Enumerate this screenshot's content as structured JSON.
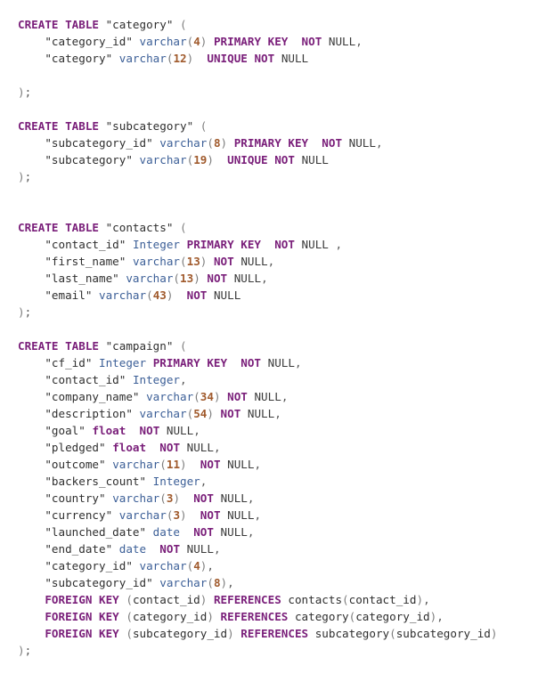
{
  "code_block": {
    "lines": [
      [
        [
          "kw",
          "CREATE TABLE"
        ],
        [
          "plain",
          " "
        ],
        [
          "str",
          "\"category\""
        ],
        [
          "plain",
          " "
        ],
        [
          "paren",
          "("
        ]
      ],
      [
        [
          "plain",
          "    "
        ],
        [
          "str",
          "\"category_id\""
        ],
        [
          "plain",
          " "
        ],
        [
          "type",
          "varchar"
        ],
        [
          "paren",
          "("
        ],
        [
          "num",
          "4"
        ],
        [
          "paren",
          ")"
        ],
        [
          "plain",
          " "
        ],
        [
          "kw",
          "PRIMARY KEY"
        ],
        [
          "plain",
          "  "
        ],
        [
          "kw",
          "NOT"
        ],
        [
          "plain",
          " "
        ],
        [
          "plain",
          "NULL"
        ],
        [
          "punct",
          ","
        ]
      ],
      [
        [
          "plain",
          "    "
        ],
        [
          "str",
          "\"category\""
        ],
        [
          "plain",
          " "
        ],
        [
          "type",
          "varchar"
        ],
        [
          "paren",
          "("
        ],
        [
          "num",
          "12"
        ],
        [
          "paren",
          ")"
        ],
        [
          "plain",
          "  "
        ],
        [
          "kw",
          "UNIQUE"
        ],
        [
          "plain",
          " "
        ],
        [
          "kw",
          "NOT"
        ],
        [
          "plain",
          " "
        ],
        [
          "plain",
          "NULL"
        ]
      ],
      [],
      [
        [
          "paren",
          ")"
        ],
        [
          "punct",
          ";"
        ]
      ],
      [],
      [
        [
          "kw",
          "CREATE TABLE"
        ],
        [
          "plain",
          " "
        ],
        [
          "str",
          "\"subcategory\""
        ],
        [
          "plain",
          " "
        ],
        [
          "paren",
          "("
        ]
      ],
      [
        [
          "plain",
          "    "
        ],
        [
          "str",
          "\"subcategory_id\""
        ],
        [
          "plain",
          " "
        ],
        [
          "type",
          "varchar"
        ],
        [
          "paren",
          "("
        ],
        [
          "num",
          "8"
        ],
        [
          "paren",
          ")"
        ],
        [
          "plain",
          " "
        ],
        [
          "kw",
          "PRIMARY KEY"
        ],
        [
          "plain",
          "  "
        ],
        [
          "kw",
          "NOT"
        ],
        [
          "plain",
          " "
        ],
        [
          "plain",
          "NULL"
        ],
        [
          "punct",
          ","
        ]
      ],
      [
        [
          "plain",
          "    "
        ],
        [
          "str",
          "\"subcategory\""
        ],
        [
          "plain",
          " "
        ],
        [
          "type",
          "varchar"
        ],
        [
          "paren",
          "("
        ],
        [
          "num",
          "19"
        ],
        [
          "paren",
          ")"
        ],
        [
          "plain",
          "  "
        ],
        [
          "kw",
          "UNIQUE"
        ],
        [
          "plain",
          " "
        ],
        [
          "kw",
          "NOT"
        ],
        [
          "plain",
          " "
        ],
        [
          "plain",
          "NULL"
        ]
      ],
      [
        [
          "paren",
          ")"
        ],
        [
          "punct",
          ";"
        ]
      ],
      [],
      [],
      [
        [
          "kw",
          "CREATE TABLE"
        ],
        [
          "plain",
          " "
        ],
        [
          "str",
          "\"contacts\""
        ],
        [
          "plain",
          " "
        ],
        [
          "paren",
          "("
        ]
      ],
      [
        [
          "plain",
          "    "
        ],
        [
          "str",
          "\"contact_id\""
        ],
        [
          "plain",
          " "
        ],
        [
          "type",
          "Integer"
        ],
        [
          "plain",
          " "
        ],
        [
          "kw",
          "PRIMARY KEY"
        ],
        [
          "plain",
          "  "
        ],
        [
          "kw",
          "NOT"
        ],
        [
          "plain",
          " "
        ],
        [
          "plain",
          "NULL"
        ],
        [
          "plain",
          " "
        ],
        [
          "punct",
          ","
        ]
      ],
      [
        [
          "plain",
          "    "
        ],
        [
          "str",
          "\"first_name\""
        ],
        [
          "plain",
          " "
        ],
        [
          "type",
          "varchar"
        ],
        [
          "paren",
          "("
        ],
        [
          "num",
          "13"
        ],
        [
          "paren",
          ")"
        ],
        [
          "plain",
          " "
        ],
        [
          "kw",
          "NOT"
        ],
        [
          "plain",
          " "
        ],
        [
          "plain",
          "NULL"
        ],
        [
          "punct",
          ","
        ]
      ],
      [
        [
          "plain",
          "    "
        ],
        [
          "str",
          "\"last_name\""
        ],
        [
          "plain",
          " "
        ],
        [
          "type",
          "varchar"
        ],
        [
          "paren",
          "("
        ],
        [
          "num",
          "13"
        ],
        [
          "paren",
          ")"
        ],
        [
          "plain",
          " "
        ],
        [
          "kw",
          "NOT"
        ],
        [
          "plain",
          " "
        ],
        [
          "plain",
          "NULL"
        ],
        [
          "punct",
          ","
        ]
      ],
      [
        [
          "plain",
          "    "
        ],
        [
          "str",
          "\"email\""
        ],
        [
          "plain",
          " "
        ],
        [
          "type",
          "varchar"
        ],
        [
          "paren",
          "("
        ],
        [
          "num",
          "43"
        ],
        [
          "paren",
          ")"
        ],
        [
          "plain",
          "  "
        ],
        [
          "kw",
          "NOT"
        ],
        [
          "plain",
          " "
        ],
        [
          "plain",
          "NULL"
        ]
      ],
      [
        [
          "paren",
          ")"
        ],
        [
          "punct",
          ";"
        ]
      ],
      [],
      [
        [
          "kw",
          "CREATE TABLE"
        ],
        [
          "plain",
          " "
        ],
        [
          "str",
          "\"campaign\""
        ],
        [
          "plain",
          " "
        ],
        [
          "paren",
          "("
        ]
      ],
      [
        [
          "plain",
          "    "
        ],
        [
          "str",
          "\"cf_id\""
        ],
        [
          "plain",
          " "
        ],
        [
          "type",
          "Integer"
        ],
        [
          "plain",
          " "
        ],
        [
          "kw",
          "PRIMARY KEY"
        ],
        [
          "plain",
          "  "
        ],
        [
          "kw",
          "NOT"
        ],
        [
          "plain",
          " "
        ],
        [
          "plain",
          "NULL"
        ],
        [
          "punct",
          ","
        ]
      ],
      [
        [
          "plain",
          "    "
        ],
        [
          "str",
          "\"contact_id\""
        ],
        [
          "plain",
          " "
        ],
        [
          "type",
          "Integer"
        ],
        [
          "punct",
          ","
        ]
      ],
      [
        [
          "plain",
          "    "
        ],
        [
          "str",
          "\"company_name\""
        ],
        [
          "plain",
          " "
        ],
        [
          "type",
          "varchar"
        ],
        [
          "paren",
          "("
        ],
        [
          "num",
          "34"
        ],
        [
          "paren",
          ")"
        ],
        [
          "plain",
          " "
        ],
        [
          "kw",
          "NOT"
        ],
        [
          "plain",
          " "
        ],
        [
          "plain",
          "NULL"
        ],
        [
          "punct",
          ","
        ]
      ],
      [
        [
          "plain",
          "    "
        ],
        [
          "str",
          "\"description\""
        ],
        [
          "plain",
          " "
        ],
        [
          "type",
          "varchar"
        ],
        [
          "paren",
          "("
        ],
        [
          "num",
          "54"
        ],
        [
          "paren",
          ")"
        ],
        [
          "plain",
          " "
        ],
        [
          "kw",
          "NOT"
        ],
        [
          "plain",
          " "
        ],
        [
          "plain",
          "NULL"
        ],
        [
          "punct",
          ","
        ]
      ],
      [
        [
          "plain",
          "    "
        ],
        [
          "str",
          "\"goal\""
        ],
        [
          "plain",
          " "
        ],
        [
          "kw",
          "float"
        ],
        [
          "plain",
          "  "
        ],
        [
          "kw",
          "NOT"
        ],
        [
          "plain",
          " "
        ],
        [
          "plain",
          "NULL"
        ],
        [
          "punct",
          ","
        ]
      ],
      [
        [
          "plain",
          "    "
        ],
        [
          "str",
          "\"pledged\""
        ],
        [
          "plain",
          " "
        ],
        [
          "kw",
          "float"
        ],
        [
          "plain",
          "  "
        ],
        [
          "kw",
          "NOT"
        ],
        [
          "plain",
          " "
        ],
        [
          "plain",
          "NULL"
        ],
        [
          "punct",
          ","
        ]
      ],
      [
        [
          "plain",
          "    "
        ],
        [
          "str",
          "\"outcome\""
        ],
        [
          "plain",
          " "
        ],
        [
          "type",
          "varchar"
        ],
        [
          "paren",
          "("
        ],
        [
          "num",
          "11"
        ],
        [
          "paren",
          ")"
        ],
        [
          "plain",
          "  "
        ],
        [
          "kw",
          "NOT"
        ],
        [
          "plain",
          " "
        ],
        [
          "plain",
          "NULL"
        ],
        [
          "punct",
          ","
        ]
      ],
      [
        [
          "plain",
          "    "
        ],
        [
          "str",
          "\"backers_count\""
        ],
        [
          "plain",
          " "
        ],
        [
          "type",
          "Integer"
        ],
        [
          "punct",
          ","
        ]
      ],
      [
        [
          "plain",
          "    "
        ],
        [
          "str",
          "\"country\""
        ],
        [
          "plain",
          " "
        ],
        [
          "type",
          "varchar"
        ],
        [
          "paren",
          "("
        ],
        [
          "num",
          "3"
        ],
        [
          "paren",
          ")"
        ],
        [
          "plain",
          "  "
        ],
        [
          "kw",
          "NOT"
        ],
        [
          "plain",
          " "
        ],
        [
          "plain",
          "NULL"
        ],
        [
          "punct",
          ","
        ]
      ],
      [
        [
          "plain",
          "    "
        ],
        [
          "str",
          "\"currency\""
        ],
        [
          "plain",
          " "
        ],
        [
          "type",
          "varchar"
        ],
        [
          "paren",
          "("
        ],
        [
          "num",
          "3"
        ],
        [
          "paren",
          ")"
        ],
        [
          "plain",
          "  "
        ],
        [
          "kw",
          "NOT"
        ],
        [
          "plain",
          " "
        ],
        [
          "plain",
          "NULL"
        ],
        [
          "punct",
          ","
        ]
      ],
      [
        [
          "plain",
          "    "
        ],
        [
          "str",
          "\"launched_date\""
        ],
        [
          "plain",
          " "
        ],
        [
          "type",
          "date"
        ],
        [
          "plain",
          "  "
        ],
        [
          "kw",
          "NOT"
        ],
        [
          "plain",
          " "
        ],
        [
          "plain",
          "NULL"
        ],
        [
          "punct",
          ","
        ]
      ],
      [
        [
          "plain",
          "    "
        ],
        [
          "str",
          "\"end_date\""
        ],
        [
          "plain",
          " "
        ],
        [
          "type",
          "date"
        ],
        [
          "plain",
          "  "
        ],
        [
          "kw",
          "NOT"
        ],
        [
          "plain",
          " "
        ],
        [
          "plain",
          "NULL"
        ],
        [
          "punct",
          ","
        ]
      ],
      [
        [
          "plain",
          "    "
        ],
        [
          "str",
          "\"category_id\""
        ],
        [
          "plain",
          " "
        ],
        [
          "type",
          "varchar"
        ],
        [
          "paren",
          "("
        ],
        [
          "num",
          "4"
        ],
        [
          "paren",
          ")"
        ],
        [
          "punct",
          ","
        ]
      ],
      [
        [
          "plain",
          "    "
        ],
        [
          "str",
          "\"subcategory_id\""
        ],
        [
          "plain",
          " "
        ],
        [
          "type",
          "varchar"
        ],
        [
          "paren",
          "("
        ],
        [
          "num",
          "8"
        ],
        [
          "paren",
          ")"
        ],
        [
          "punct",
          ","
        ]
      ],
      [
        [
          "plain",
          "    "
        ],
        [
          "kw",
          "FOREIGN KEY"
        ],
        [
          "plain",
          " "
        ],
        [
          "paren",
          "("
        ],
        [
          "ident",
          "contact_id"
        ],
        [
          "paren",
          ")"
        ],
        [
          "plain",
          " "
        ],
        [
          "kw",
          "REFERENCES"
        ],
        [
          "plain",
          " "
        ],
        [
          "ident",
          "contacts"
        ],
        [
          "paren",
          "("
        ],
        [
          "ident",
          "contact_id"
        ],
        [
          "paren",
          ")"
        ],
        [
          "punct",
          ","
        ]
      ],
      [
        [
          "plain",
          "    "
        ],
        [
          "kw",
          "FOREIGN KEY"
        ],
        [
          "plain",
          " "
        ],
        [
          "paren",
          "("
        ],
        [
          "ident",
          "category_id"
        ],
        [
          "paren",
          ")"
        ],
        [
          "plain",
          " "
        ],
        [
          "kw",
          "REFERENCES"
        ],
        [
          "plain",
          " "
        ],
        [
          "ident",
          "category"
        ],
        [
          "paren",
          "("
        ],
        [
          "ident",
          "category_id"
        ],
        [
          "paren",
          ")"
        ],
        [
          "punct",
          ","
        ]
      ],
      [
        [
          "plain",
          "    "
        ],
        [
          "kw",
          "FOREIGN KEY"
        ],
        [
          "plain",
          " "
        ],
        [
          "paren",
          "("
        ],
        [
          "ident",
          "subcategory_id"
        ],
        [
          "paren",
          ")"
        ],
        [
          "plain",
          " "
        ],
        [
          "kw",
          "REFERENCES"
        ],
        [
          "plain",
          " "
        ],
        [
          "ident",
          "subcategory"
        ],
        [
          "paren",
          "("
        ],
        [
          "ident",
          "subcategory_id"
        ],
        [
          "paren",
          ")"
        ]
      ],
      [
        [
          "paren",
          ")"
        ],
        [
          "punct",
          ";"
        ]
      ]
    ]
  }
}
